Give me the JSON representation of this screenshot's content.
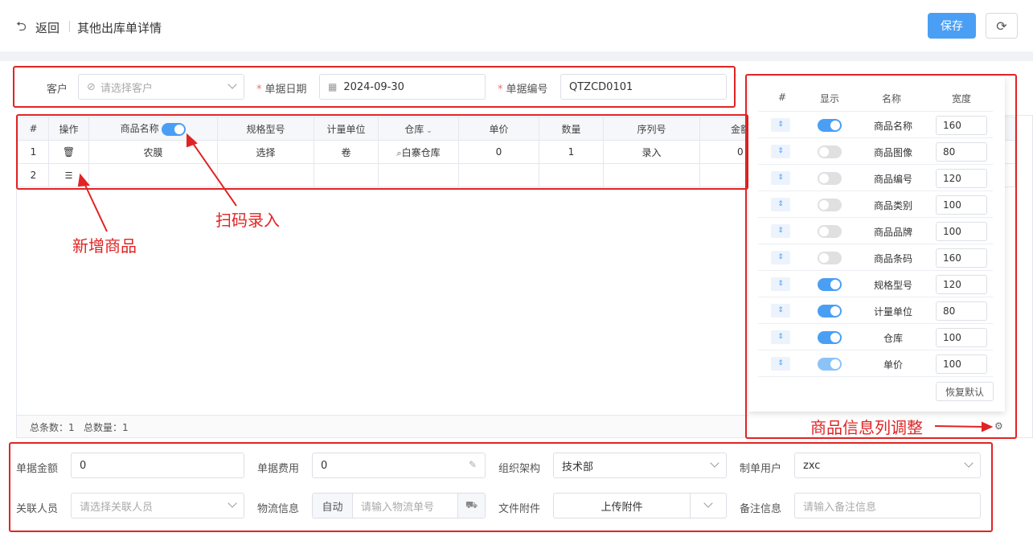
{
  "header": {
    "back_label": "返回",
    "page_title": "其他出库单详情",
    "save_label": "保存"
  },
  "form": {
    "customer_label": "客户",
    "customer_placeholder": "请选择客户",
    "date_label": "单据日期",
    "date_value": "2024-09-30",
    "code_label": "单据编号",
    "code_value": "QTZCD0101"
  },
  "table": {
    "headers": [
      "#",
      "操作",
      "商品名称",
      "规格型号",
      "计量单位",
      "仓库",
      "单价",
      "数量",
      "序列号",
      "金额"
    ],
    "row1": {
      "no": "1",
      "name": "农膜",
      "spec": "选择",
      "unit": "卷",
      "warehouse": "白寨仓库",
      "price": "0",
      "qty": "1",
      "serial": "录入",
      "amount": "0"
    },
    "row2": {
      "no": "2"
    },
    "footer_total_rows": "总条数：1",
    "footer_total_qty": "总数量：1"
  },
  "annotations": {
    "new_item": "新增商品",
    "scan_entry": "扫码录入",
    "column_adjust": "商品信息列调整"
  },
  "column_panel": {
    "headers": {
      "no": "#",
      "show": "显示",
      "name": "名称",
      "width": "宽度"
    },
    "rows": [
      {
        "name": "商品名称",
        "width": "160",
        "show": "on"
      },
      {
        "name": "商品图像",
        "width": "80",
        "show": "off"
      },
      {
        "name": "商品编号",
        "width": "120",
        "show": "off"
      },
      {
        "name": "商品类别",
        "width": "100",
        "show": "off"
      },
      {
        "name": "商品品牌",
        "width": "100",
        "show": "off"
      },
      {
        "name": "商品条码",
        "width": "160",
        "show": "off"
      },
      {
        "name": "规格型号",
        "width": "120",
        "show": "on"
      },
      {
        "name": "计量单位",
        "width": "80",
        "show": "on"
      },
      {
        "name": "仓库",
        "width": "100",
        "show": "on"
      },
      {
        "name": "单价",
        "width": "100",
        "show": "disabled-on"
      }
    ],
    "reset_label": "恢复默认"
  },
  "bottom": {
    "amount_label": "单据金额",
    "amount_value": "0",
    "fee_label": "单据费用",
    "fee_value": "0",
    "org_label": "组织架构",
    "org_value": "技术部",
    "creator_label": "制单用户",
    "creator_value": "zxc",
    "related_label": "关联人员",
    "related_placeholder": "请选择关联人员",
    "logistics_label": "物流信息",
    "logistics_auto": "自动",
    "logistics_placeholder": "请输入物流单号",
    "attach_label": "文件附件",
    "attach_button": "上传附件",
    "remark_label": "备注信息",
    "remark_placeholder": "请输入备注信息"
  },
  "colors": {
    "primary": "#4a9ff5",
    "annotation_red": "#e02424"
  }
}
